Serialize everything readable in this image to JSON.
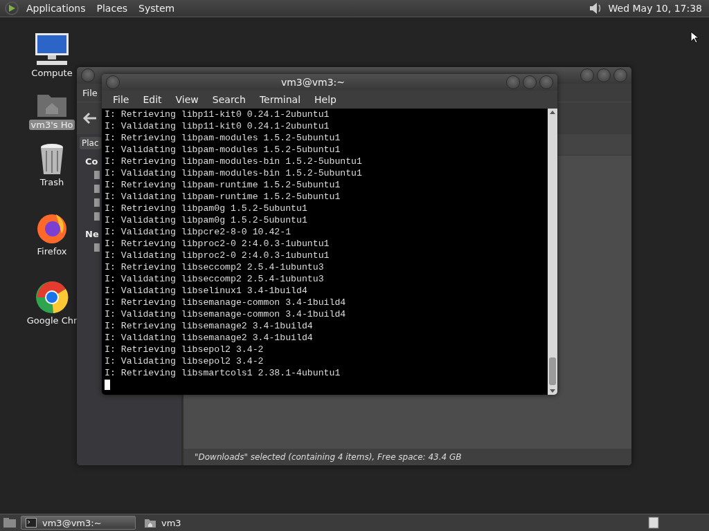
{
  "top_panel": {
    "menus": [
      "Applications",
      "Places",
      "System"
    ],
    "clock": "Wed May 10, 17:38"
  },
  "desktop_icons": [
    {
      "label": "Compute",
      "kind": "computer",
      "selected": false
    },
    {
      "label": "vm3's Ho",
      "kind": "home",
      "selected": true
    },
    {
      "label": "Trash",
      "kind": "trash",
      "selected": false
    },
    {
      "label": "Firefox",
      "kind": "firefox",
      "selected": false
    },
    {
      "label": "Google Chr",
      "kind": "chrome",
      "selected": false
    }
  ],
  "file_manager": {
    "menus": [
      "File"
    ],
    "places_button": "Plac",
    "sidebar_sections": [
      {
        "heading": "Co"
      },
      {
        "heading": "Ne"
      }
    ],
    "status": "\"Downloads\" selected (containing 4 items), Free space: 43.4 GB"
  },
  "terminal": {
    "title": "vm3@vm3:~",
    "menus": [
      "File",
      "Edit",
      "View",
      "Search",
      "Terminal",
      "Help"
    ],
    "lines": [
      "I: Retrieving libp11-kit0 0.24.1-2ubuntu1",
      "I: Validating libp11-kit0 0.24.1-2ubuntu1",
      "I: Retrieving libpam-modules 1.5.2-5ubuntu1",
      "I: Validating libpam-modules 1.5.2-5ubuntu1",
      "I: Retrieving libpam-modules-bin 1.5.2-5ubuntu1",
      "I: Validating libpam-modules-bin 1.5.2-5ubuntu1",
      "I: Retrieving libpam-runtime 1.5.2-5ubuntu1",
      "I: Validating libpam-runtime 1.5.2-5ubuntu1",
      "I: Retrieving libpam0g 1.5.2-5ubuntu1",
      "I: Validating libpam0g 1.5.2-5ubuntu1",
      "I: Validating libpcre2-8-0 10.42-1",
      "I: Retrieving libproc2-0 2:4.0.3-1ubuntu1",
      "I: Validating libproc2-0 2:4.0.3-1ubuntu1",
      "I: Retrieving libseccomp2 2.5.4-1ubuntu3",
      "I: Validating libseccomp2 2.5.4-1ubuntu3",
      "I: Validating libselinux1 3.4-1build4",
      "I: Retrieving libsemanage-common 3.4-1build4",
      "I: Validating libsemanage-common 3.4-1build4",
      "I: Retrieving libsemanage2 3.4-1build4",
      "I: Validating libsemanage2 3.4-1build4",
      "I: Retrieving libsepol2 3.4-2",
      "I: Validating libsepol2 3.4-2",
      "I: Retrieving libsmartcols1 2.38.1-4ubuntu1"
    ]
  },
  "taskbar": {
    "tasks": [
      {
        "label": "vm3@vm3:~",
        "kind": "terminal",
        "selected": true
      },
      {
        "label": "vm3",
        "kind": "folder",
        "selected": false
      }
    ]
  }
}
